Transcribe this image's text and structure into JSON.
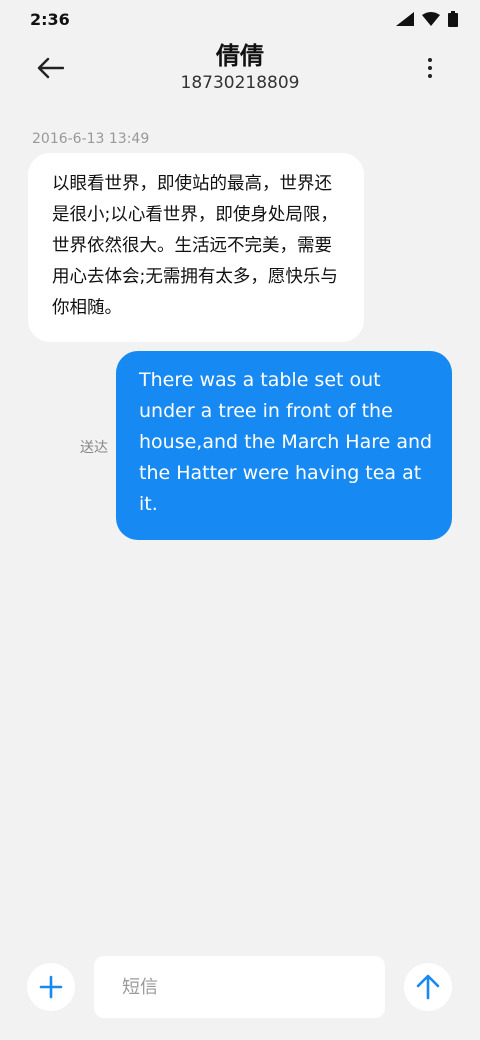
{
  "status_bar": {
    "time": "2:36",
    "icons": [
      "signal-icon",
      "wifi-icon",
      "battery-icon"
    ]
  },
  "header": {
    "contact_name": "倩倩",
    "contact_number": "18730218809",
    "back_icon": "back-arrow-icon",
    "more_icon": "more-vertical-icon"
  },
  "conversation": {
    "timestamp": "2016-6-13 13:49",
    "messages": [
      {
        "direction": "incoming",
        "text": "以眼看世界，即使站的最高，世界还是很小;以心看世界，即使身处局限，世界依然很大。生活远不完美，需要用心去体会;无需拥有太多，愿快乐与你相随。"
      },
      {
        "direction": "outgoing",
        "status": "送达",
        "text": "There was a table set out under a tree in front of the house,and the March Hare and the Hatter were having tea at it."
      }
    ]
  },
  "composer": {
    "placeholder": "短信",
    "value": "",
    "add_icon": "plus-icon",
    "send_icon": "send-arrow-icon"
  },
  "colors": {
    "background": "#f2f2f2",
    "incoming_bubble": "#ffffff",
    "outgoing_bubble": "#1789f2",
    "accent": "#1789f2"
  }
}
